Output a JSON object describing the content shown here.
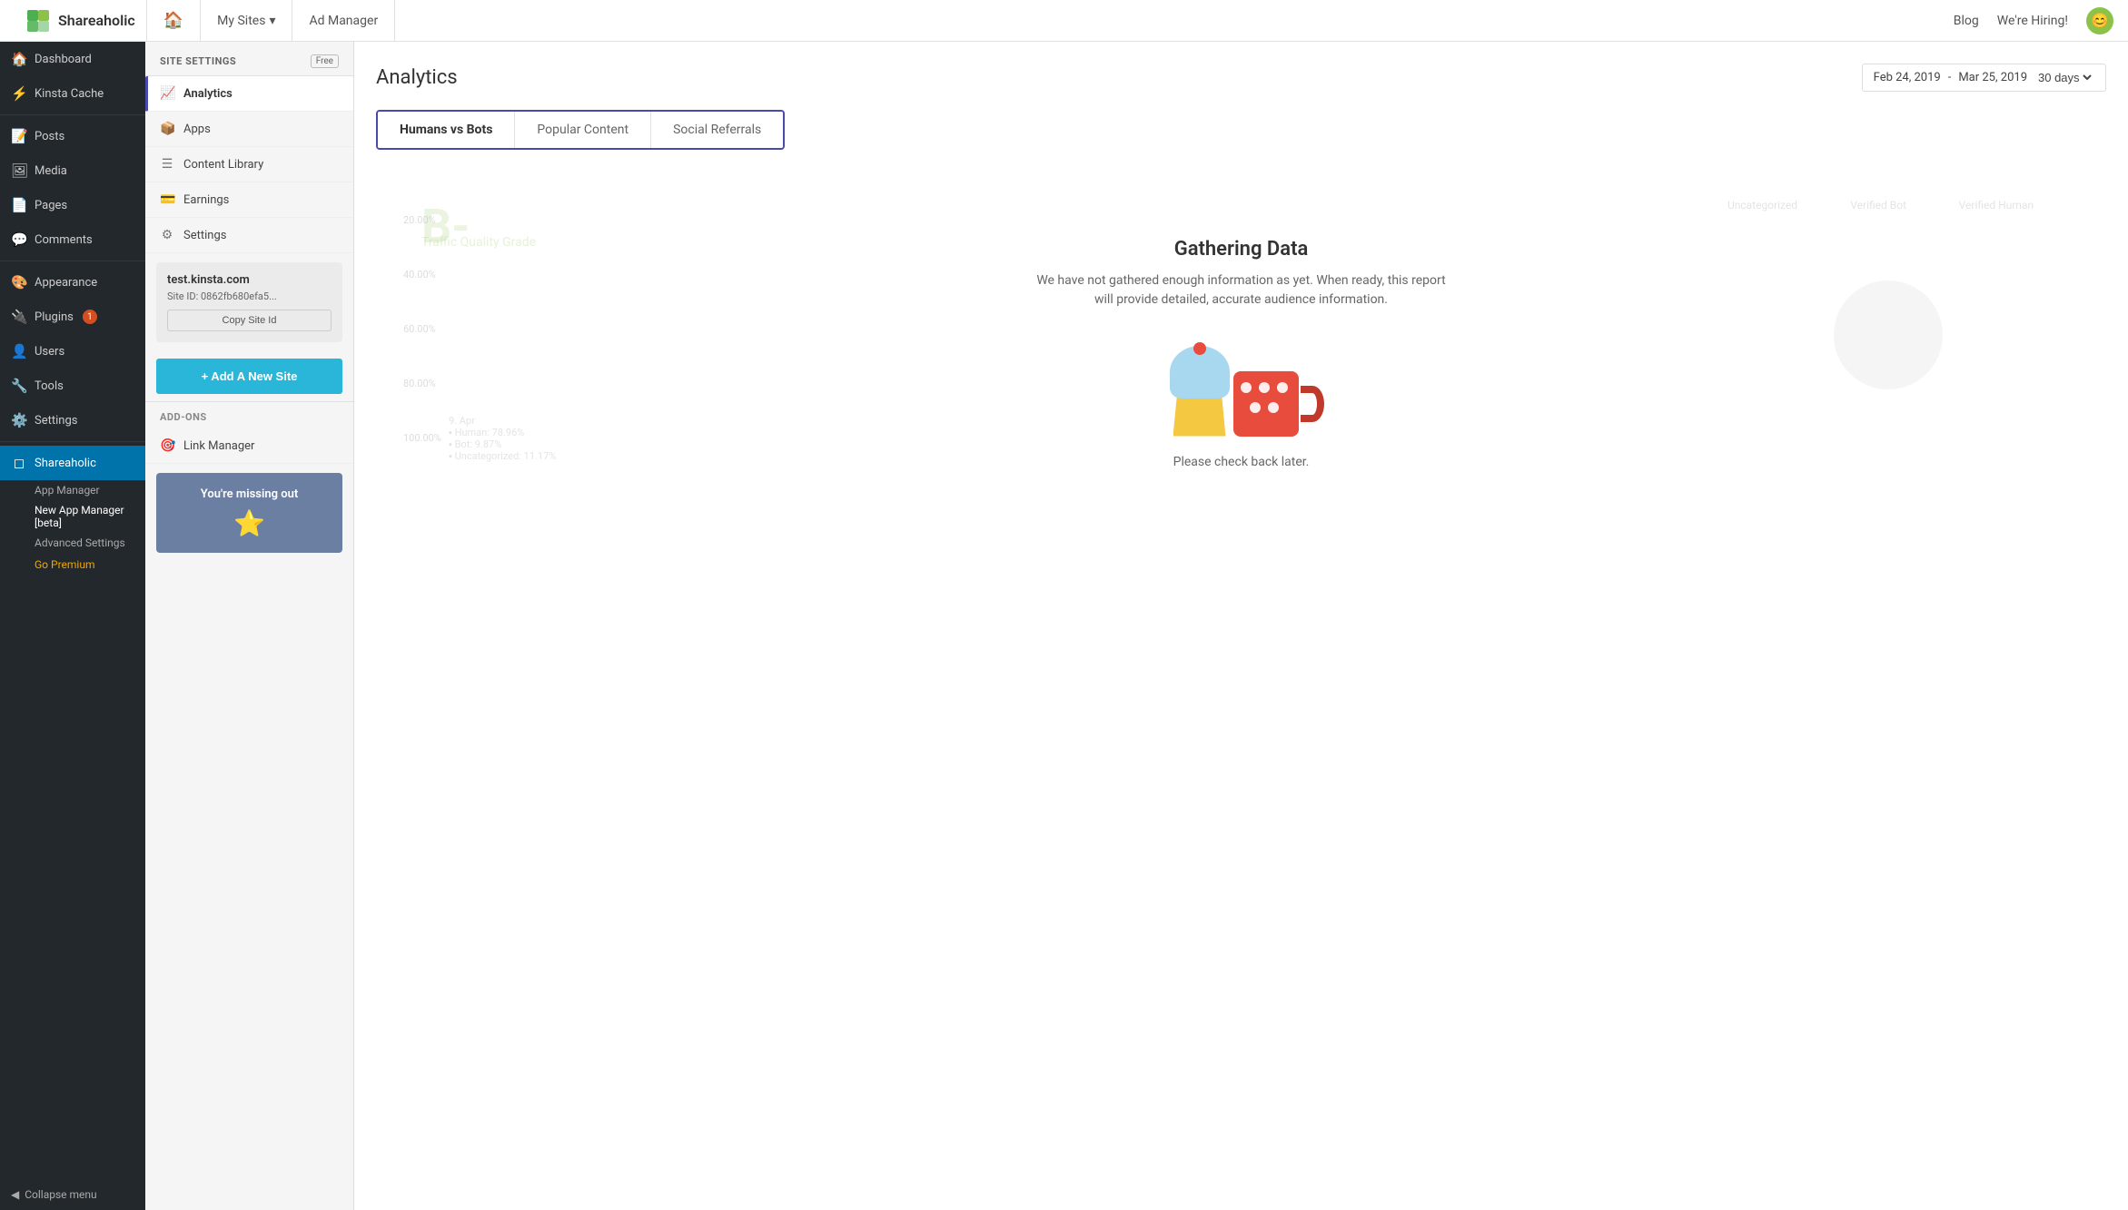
{
  "topnav": {
    "logo_text": "Shareaholic",
    "home_icon": "🏠",
    "my_sites_label": "My Sites",
    "ad_manager_label": "Ad Manager",
    "blog_label": "Blog",
    "hiring_label": "We're Hiring!",
    "avatar_emoji": "😊"
  },
  "wp_sidebar": {
    "items": [
      {
        "id": "dashboard",
        "icon": "🏠",
        "label": "Dashboard"
      },
      {
        "id": "kinsta-cache",
        "icon": "⚡",
        "label": "Kinsta Cache"
      },
      {
        "id": "posts",
        "icon": "📝",
        "label": "Posts"
      },
      {
        "id": "media",
        "icon": "🖼",
        "label": "Media"
      },
      {
        "id": "pages",
        "icon": "📄",
        "label": "Pages"
      },
      {
        "id": "comments",
        "icon": "💬",
        "label": "Comments"
      },
      {
        "id": "appearance",
        "icon": "🎨",
        "label": "Appearance"
      },
      {
        "id": "plugins",
        "icon": "🔌",
        "label": "Plugins",
        "badge": "1"
      },
      {
        "id": "users",
        "icon": "👤",
        "label": "Users"
      },
      {
        "id": "tools",
        "icon": "🔧",
        "label": "Tools"
      },
      {
        "id": "settings",
        "icon": "⚙️",
        "label": "Settings"
      },
      {
        "id": "shareaholic",
        "icon": "◻",
        "label": "Shareaholic",
        "active": true
      }
    ],
    "sub_items": [
      {
        "id": "app-manager",
        "label": "App Manager"
      },
      {
        "id": "new-app-manager",
        "label": "New App Manager [beta]",
        "active": true
      },
      {
        "id": "advanced-settings",
        "label": "Advanced Settings"
      }
    ],
    "go_premium_label": "Go Premium",
    "collapse_label": "Collapse menu"
  },
  "shareaholic_sidebar": {
    "site_settings_label": "SITE SETTINGS",
    "free_badge": "Free",
    "nav_items": [
      {
        "id": "analytics",
        "icon": "📈",
        "label": "Analytics",
        "active": true
      },
      {
        "id": "apps",
        "icon": "📦",
        "label": "Apps"
      },
      {
        "id": "content-library",
        "icon": "☰",
        "label": "Content Library"
      },
      {
        "id": "earnings",
        "icon": "💳",
        "label": "Earnings"
      },
      {
        "id": "settings",
        "icon": "⚙",
        "label": "Settings"
      }
    ],
    "site_domain": "test.kinsta.com",
    "site_id_label": "Site ID:",
    "site_id_value": "0862fb680efa5...",
    "copy_site_id_label": "Copy Site Id",
    "add_site_label": "+ Add A New Site",
    "addons_label": "ADD-ONS",
    "link_manager_label": "Link Manager",
    "link_manager_icon": "🎯",
    "missing_out_title": "You're missing out"
  },
  "analytics": {
    "title": "Analytics",
    "date_from": "Feb 24, 2019",
    "date_separator": "-",
    "date_to": "Mar 25, 2019",
    "date_range": "30 days",
    "tabs": [
      {
        "id": "humans-vs-bots",
        "label": "Humans vs Bots",
        "active": true
      },
      {
        "id": "popular-content",
        "label": "Popular Content"
      },
      {
        "id": "social-referrals",
        "label": "Social Referrals"
      }
    ],
    "gathering_title": "Gathering Data",
    "gathering_desc": "We have not gathered enough information as yet. When ready, this report will provide detailed, accurate audience information.",
    "gathering_note": "Please check back later.",
    "traffic_grade_bg": "B-",
    "traffic_grade_label": "Traffic Quality Grade"
  }
}
